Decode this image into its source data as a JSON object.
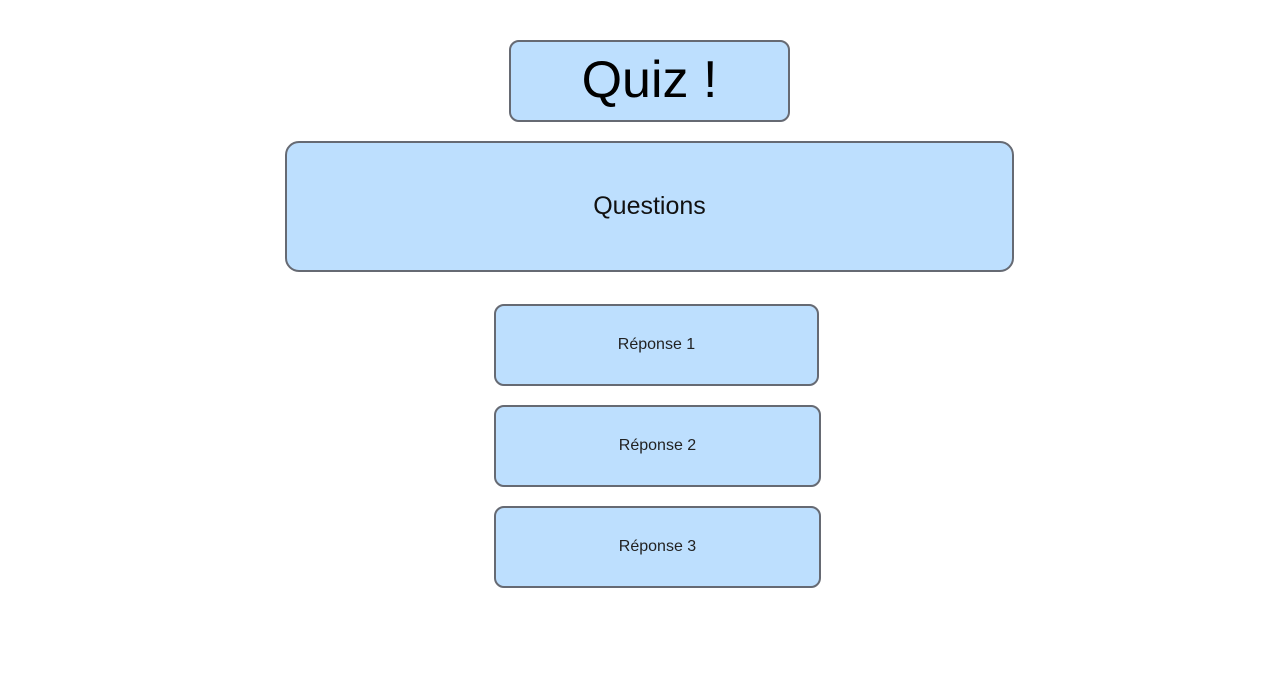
{
  "title": "Quiz !",
  "question": "Questions",
  "answers": [
    {
      "label": "Réponse 1"
    },
    {
      "label": "Réponse 2"
    },
    {
      "label": "Réponse 3"
    }
  ],
  "colors": {
    "box_fill": "#bddffe",
    "box_border": "#666a73",
    "background": "#ffffff"
  }
}
